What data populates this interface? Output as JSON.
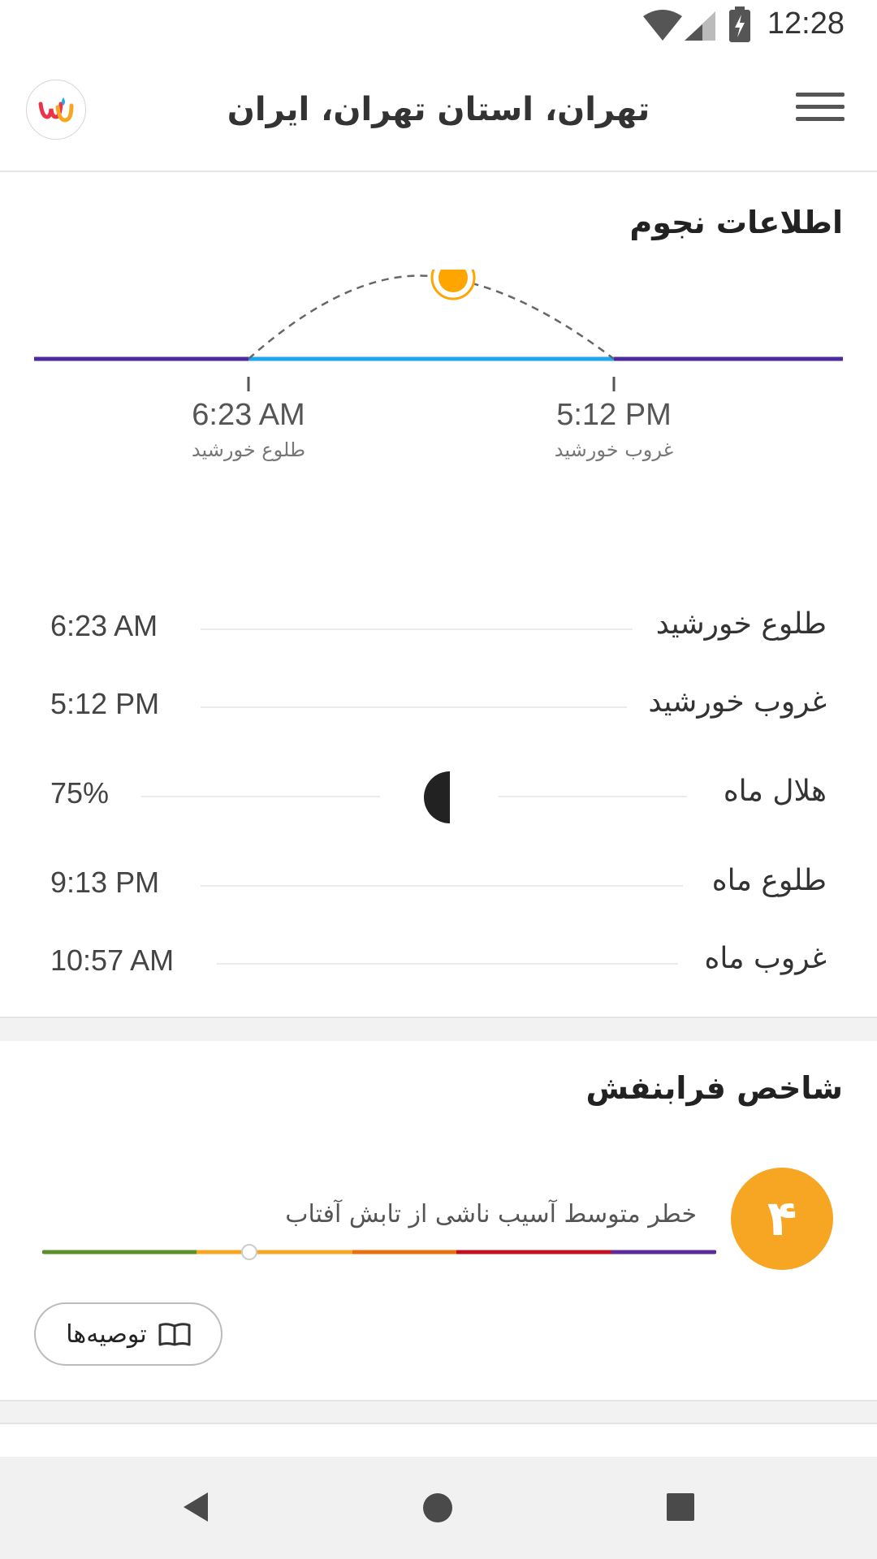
{
  "status_bar": {
    "time": "12:28"
  },
  "header": {
    "location": "تهران، استان تهران، ایران",
    "logo_icon": "weather-underground-logo",
    "menu_icon": "hamburger-menu-icon"
  },
  "astronomy": {
    "title": "اطلاعات نجوم",
    "diagram": {
      "sunrise_time": "6:23 AM",
      "sunrise_label": "طلوع خورشید",
      "sunset_time": "5:12 PM",
      "sunset_label": "غروب خورشید"
    },
    "rows": [
      {
        "label": "طلوع خورشید",
        "value": "6:23 AM"
      },
      {
        "label": "غروب خورشید",
        "value": "5:12 PM"
      },
      {
        "label": "هلال ماه",
        "value": "75%"
      },
      {
        "label": "طلوع ماه",
        "value": "9:13 PM"
      },
      {
        "label": "غروب ماه",
        "value": "10:57 AM"
      }
    ]
  },
  "uv": {
    "title": "شاخص فرابنفش",
    "index": "۴",
    "description": "خطر متوسط آسیب ناشی از تابش آفتاب",
    "level": 4,
    "recommend_label": "توصیه‌ها",
    "colors": {
      "badge": "#f6a623",
      "green": "#5a8f29",
      "yellow": "#f6a623",
      "orange": "#e8700f",
      "red": "#c0121e",
      "purple": "#5b2a9a"
    }
  },
  "colors": {
    "sun": "#ffa500",
    "day_line": "#1ea6ef",
    "night_line": "#4b2aa0"
  }
}
